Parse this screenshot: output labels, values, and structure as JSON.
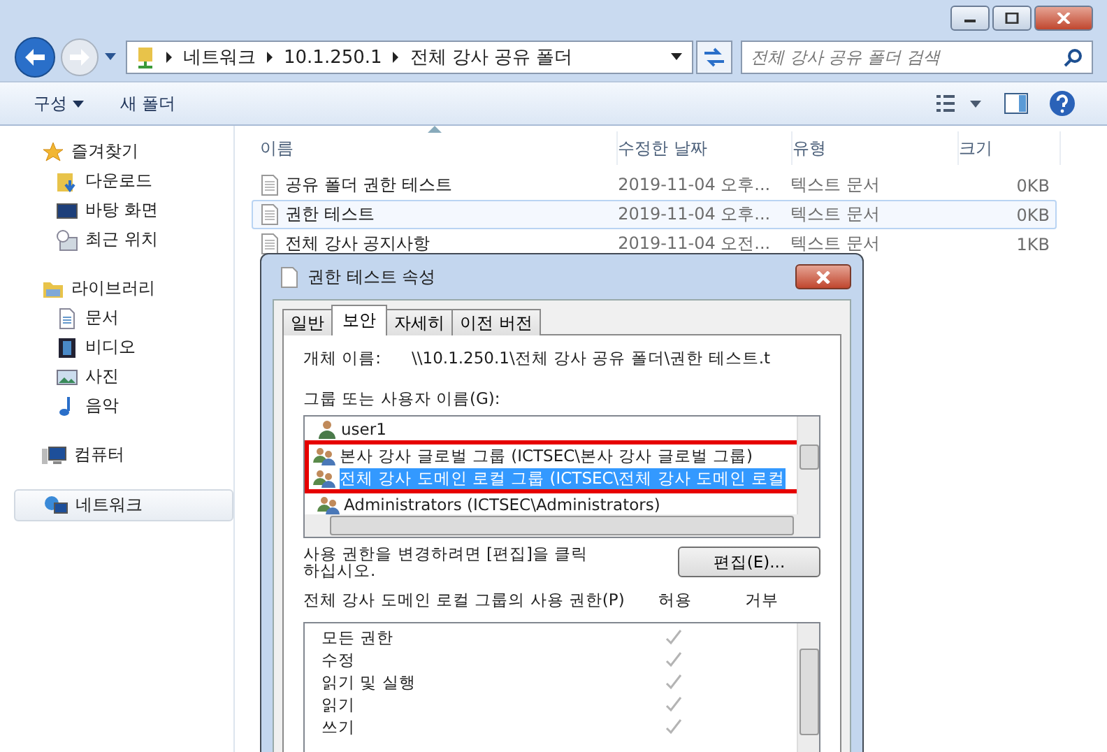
{
  "address_bar": {
    "crumbs": [
      "네트워크",
      "10.1.250.1",
      "전체 강사 공유 폴더"
    ]
  },
  "search": {
    "placeholder": "전체 강사 공유 폴더 검색"
  },
  "toolbar": {
    "organize": "구성",
    "new_folder": "새 폴더"
  },
  "sidebar": [
    {
      "label": "즐겨찾기",
      "kind": "star",
      "selected": false,
      "children": [
        {
          "label": "다운로드",
          "kind": "download",
          "selected": false
        },
        {
          "label": "바탕 화면",
          "kind": "desktop",
          "selected": false
        },
        {
          "label": "최근 위치",
          "kind": "recent",
          "selected": false
        }
      ]
    },
    {
      "label": "라이브러리",
      "kind": "library",
      "selected": false,
      "children": [
        {
          "label": "문서",
          "kind": "doc",
          "selected": false
        },
        {
          "label": "비디오",
          "kind": "video",
          "selected": false
        },
        {
          "label": "사진",
          "kind": "picture",
          "selected": false
        },
        {
          "label": "음악",
          "kind": "music",
          "selected": false
        }
      ]
    },
    {
      "label": "컴퓨터",
      "kind": "computer",
      "selected": false
    },
    {
      "label": "네트워크",
      "kind": "network",
      "selected": true
    }
  ],
  "columns": [
    "이름",
    "수정한 날짜",
    "유형",
    "크기"
  ],
  "files": [
    {
      "name": "공유 폴더 권한 테스트",
      "date": "2019-11-04 오후...",
      "type": "텍스트 문서",
      "size": "0KB",
      "selected": false
    },
    {
      "name": "권한 테스트",
      "date": "2019-11-04 오후...",
      "type": "텍스트 문서",
      "size": "0KB",
      "selected": true
    },
    {
      "name": "전체 강사 공지사항",
      "date": "2019-11-04 오전...",
      "type": "텍스트 문서",
      "size": "1KB",
      "selected": false
    }
  ],
  "dialog": {
    "title": "권한 테스트 속성",
    "tabs": [
      {
        "label": "일반",
        "selected": false
      },
      {
        "label": "보안",
        "selected": true
      },
      {
        "label": "자세히",
        "selected": false
      },
      {
        "label": "이전 버전",
        "selected": false
      }
    ],
    "object_label": "개체 이름:",
    "object_value": "\\\\10.1.250.1\\전체 강사 공유 폴더\\권한 테스트.t",
    "groups_label": "그룹 또는 사용자 이름(G):",
    "groups": [
      {
        "name": "user1",
        "kind": "user",
        "selected": false,
        "highlighted": false
      },
      {
        "name": "본사 강사 글로벌 그룹 (ICTSEC\\본사 강사 글로벌 그룹)",
        "kind": "group",
        "selected": false,
        "highlighted": true
      },
      {
        "name": "전체 강사 도메인 로컬 그룹 (ICTSEC\\전체 강사 도메인 로컬",
        "kind": "group",
        "selected": true,
        "highlighted": true
      },
      {
        "name": "Administrators (ICTSEC\\Administrators)",
        "kind": "group",
        "selected": false,
        "highlighted": false
      }
    ],
    "edit_note": "사용 권한을 변경하려면 [편집]을 클릭하십시오.",
    "edit_button": "편집(E)...",
    "perm_label": "전체 강사 도메인 로컬 그룹의 사용 권한(P)",
    "allow_label": "허용",
    "deny_label": "거부",
    "permissions": [
      {
        "name": "모든 권한",
        "allow": true,
        "deny": false
      },
      {
        "name": "수정",
        "allow": true,
        "deny": false
      },
      {
        "name": "읽기 및 실행",
        "allow": true,
        "deny": false
      },
      {
        "name": "읽기",
        "allow": true,
        "deny": false
      },
      {
        "name": "쓰기",
        "allow": true,
        "deny": false
      }
    ]
  }
}
